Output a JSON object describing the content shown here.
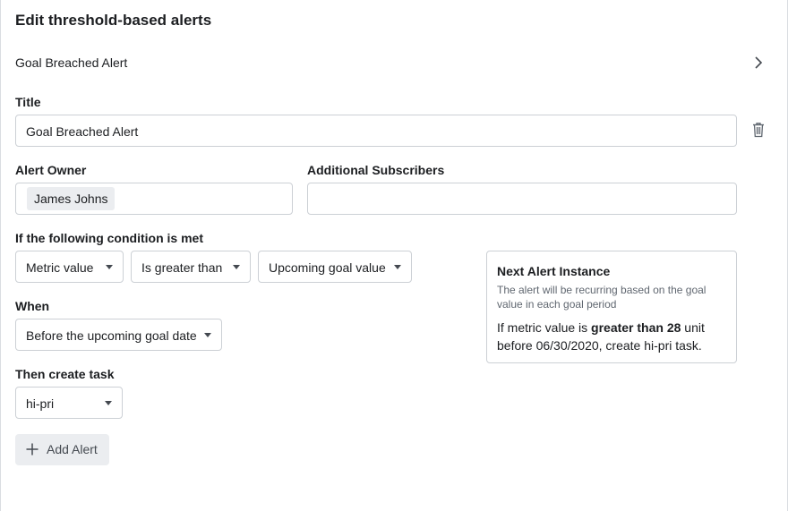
{
  "page": {
    "title": "Edit threshold-based alerts"
  },
  "alert_row": {
    "label": "Goal Breached Alert"
  },
  "title_field": {
    "label": "Title",
    "value": "Goal Breached Alert"
  },
  "owner_field": {
    "label": "Alert Owner",
    "chip": "James Johns"
  },
  "subscribers_field": {
    "label": "Additional Subscribers",
    "value": ""
  },
  "condition": {
    "label": "If the following condition is met",
    "metric": "Metric value",
    "operator": "Is greater than",
    "target": "Upcoming goal value"
  },
  "when": {
    "label": "When",
    "value": "Before the upcoming goal date"
  },
  "task": {
    "label": "Then create task",
    "value": "hi-pri"
  },
  "next_instance": {
    "title": "Next Alert Instance",
    "subtitle": "The alert will be recurring based on the goal value in each goal period",
    "body_prefix": "If metric value is ",
    "body_bold": "greater than 28",
    "body_suffix": " unit before 06/30/2020, create hi-pri task."
  },
  "add_alert": {
    "label": "Add Alert"
  },
  "icons": {
    "chevron": "chevron-right-icon",
    "trash": "trash-icon",
    "caret": "caret-down-icon",
    "plus": "plus-icon"
  }
}
